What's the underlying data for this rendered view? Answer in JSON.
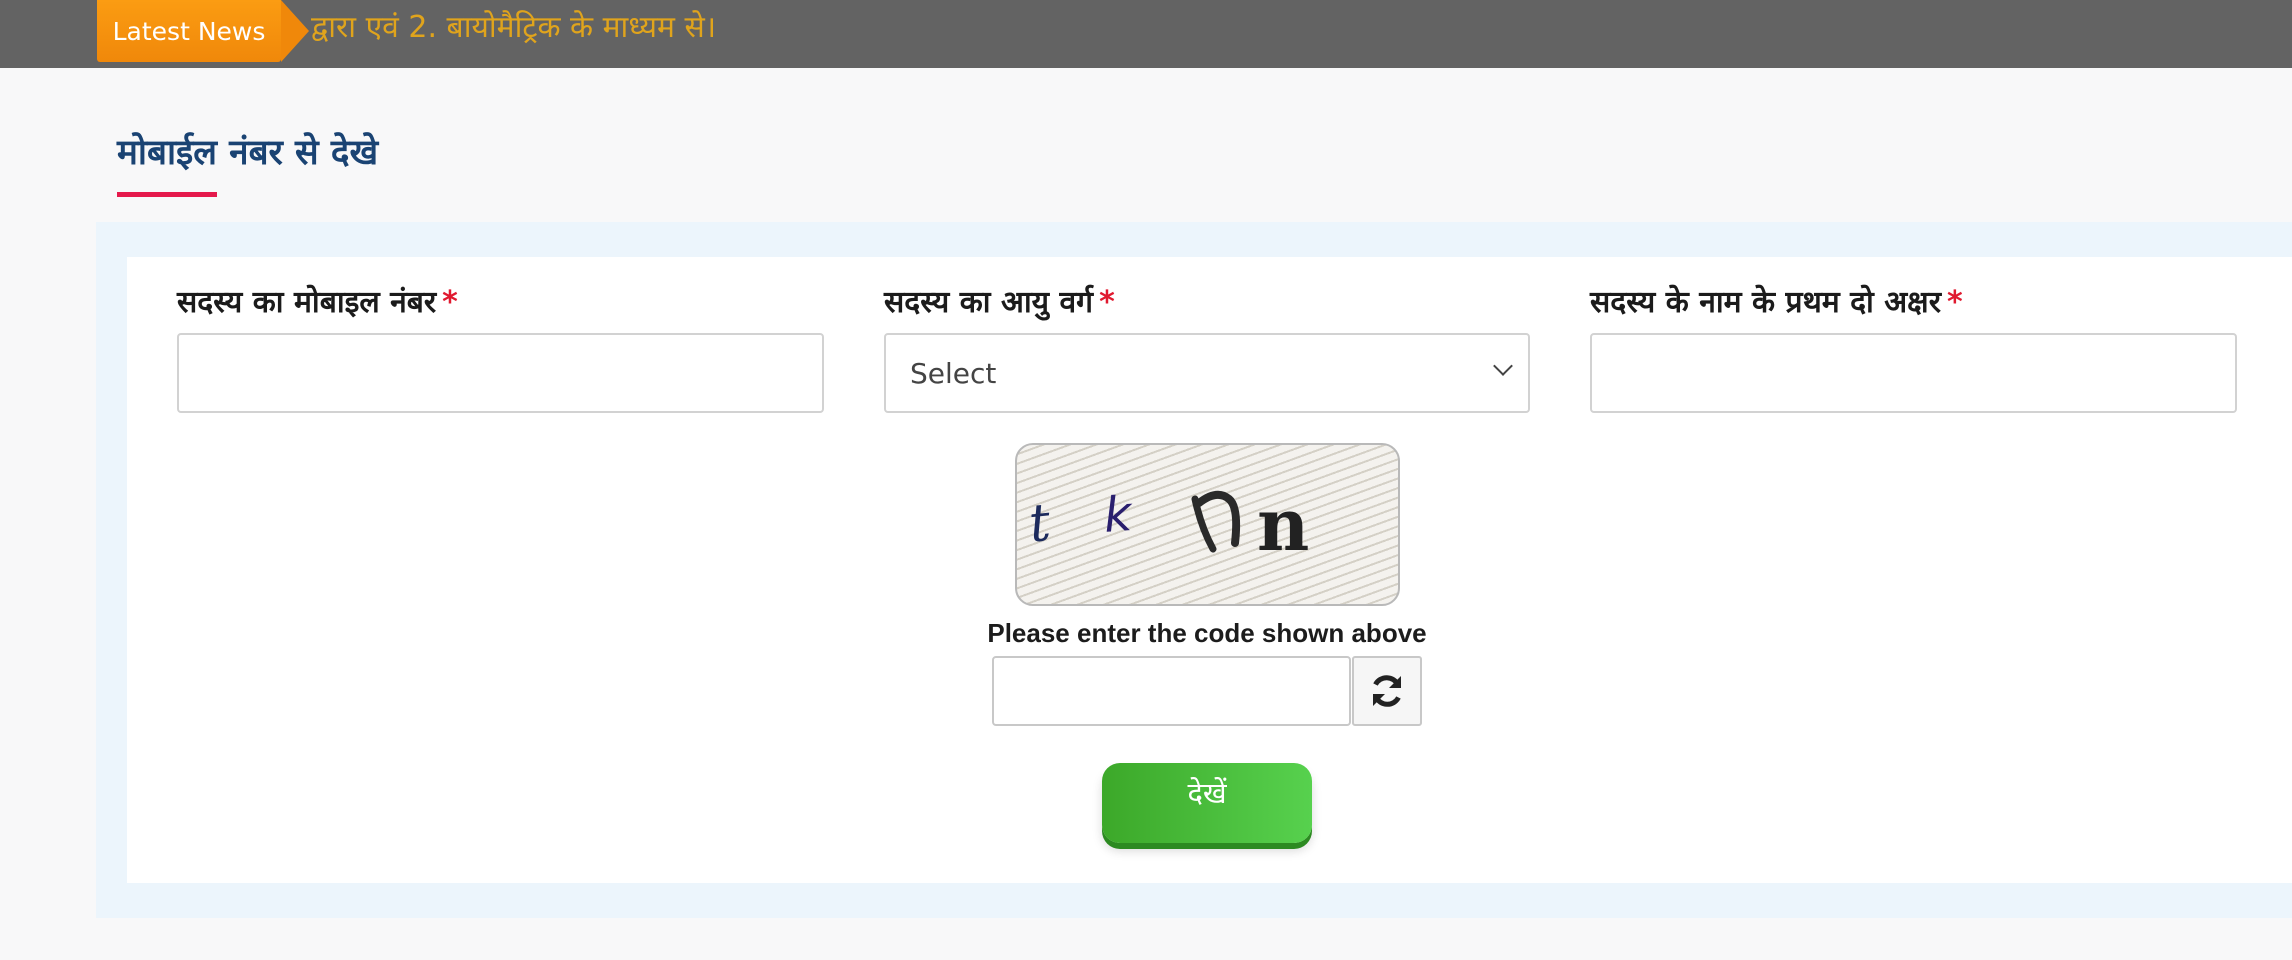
{
  "news_bar": {
    "badge_label": "Latest News",
    "ticker_text": "द्वारा एवं 2. बायोमैट्रिक के माध्यम से।"
  },
  "section": {
    "title": "मोबाईल नंबर से देखे"
  },
  "form": {
    "mobile": {
      "label": "सदस्य का मोबाइल नंबर",
      "required_mark": "*",
      "value": "",
      "placeholder": ""
    },
    "age_group": {
      "label": "सदस्य का आयु वर्ग",
      "required_mark": "*",
      "selected": "Select"
    },
    "name_initials": {
      "label": "सदस्य के नाम के प्रथम दो अक्षर",
      "required_mark": "*",
      "value": "",
      "placeholder": ""
    },
    "captcha": {
      "image_text": "tkhn",
      "caption": "Please enter the code shown above",
      "value": "",
      "refresh_icon": "refresh-icon"
    },
    "submit_label": "देखें"
  },
  "colors": {
    "news_bar_bg": "#636363",
    "badge_bg": "#f0880a",
    "ticker_text": "#e0a41c",
    "title_text": "#1a4373",
    "title_underline": "#e5194c",
    "required_mark": "#e0192f",
    "card_outer_bg": "#ecf5fc",
    "submit_bg": "#3ca829"
  }
}
